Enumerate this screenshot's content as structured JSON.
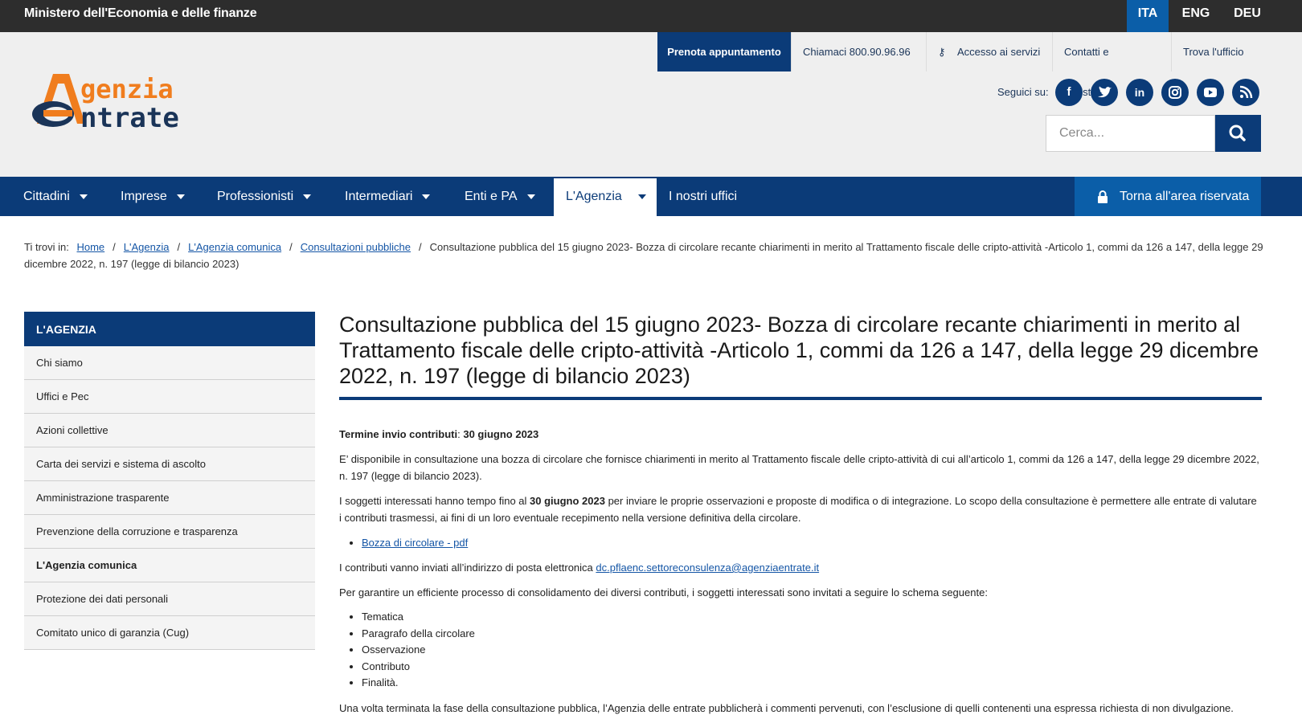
{
  "topbar": {
    "ministry": "Ministero dell'Economia e delle finanze",
    "languages": [
      "ITA",
      "ENG",
      "DEU"
    ]
  },
  "header": {
    "logo_line1": "genzia",
    "logo_line2": "ntrate",
    "services": {
      "prenota": "Prenota appuntamento",
      "chiamaci": "Chiamaci 800.90.96.96",
      "accesso": "Accesso ai servizi",
      "contatti": "Contatti e assistenza",
      "trova": "Trova l'ufficio"
    },
    "social_label": "Seguici su:",
    "social": [
      "facebook",
      "twitter",
      "linkedin",
      "instagram",
      "youtube",
      "rss"
    ],
    "search_placeholder": "Cerca..."
  },
  "nav": {
    "items": [
      "Cittadini",
      "Imprese",
      "Professionisti",
      "Intermediari",
      "Enti e PA",
      "L'Agenzia",
      "I nostri uffici"
    ],
    "reserved": "Torna all'area riservata"
  },
  "breadcrumb": {
    "label": "Ti trovi in:",
    "links": [
      "Home",
      "L'Agenzia",
      "L'Agenzia comunica",
      "Consultazioni pubbliche"
    ],
    "current": "Consultazione pubblica del 15 giugno 2023- Bozza di circolare recante chiarimenti in merito al Trattamento fiscale delle cripto-attività -Articolo 1, commi da 126 a 147, della legge 29 dicembre 2022, n. 197 (legge di bilancio 2023)"
  },
  "sidebar": {
    "title": "L'AGENZIA",
    "items": [
      "Chi siamo",
      "Uffici e Pec",
      "Azioni collettive",
      "Carta dei servizi e sistema di ascolto",
      "Amministrazione trasparente",
      "Prevenzione della corruzione e trasparenza",
      "L'Agenzia comunica",
      "Protezione dei dati personali",
      "Comitato unico di garanzia (Cug)"
    ],
    "active_item": "L'Agenzia comunica"
  },
  "main": {
    "title": "Consultazione pubblica del 15 giugno 2023- Bozza di circolare recante chiarimenti in merito al Trattamento fiscale delle cripto-attività -Articolo 1, commi da 126 a 147, della legge 29 dicembre 2022, n. 197 (legge di bilancio 2023)",
    "deadline_label": "Termine invio contributi",
    "deadline_value": "30 giugno 2023",
    "para1": "E’ disponibile in consultazione una bozza di circolare che fornisce chiarimenti in merito al Trattamento fiscale delle cripto-attività di cui all’articolo 1, commi da 126 a 147, della legge 29 dicembre 2022, n. 197 (legge di bilancio 2023).",
    "para2_before": "I soggetti interessati hanno tempo fino al ",
    "para2_bold": "30 giugno 2023",
    "para2_after": " per inviare le proprie osservazioni e proposte di modifica o di integrazione. Lo scopo della consultazione è permettere alle entrate di valutare i contributi trasmessi, ai fini di un loro eventuale recepimento nella versione definitiva della circolare.",
    "doc_link": "Bozza di circolare - pdf",
    "email_before": "I contributi vanno inviati all’indirizzo di posta elettronica ",
    "email": "dc.pflaenc.settoreconsulenza@agenziaentrate.it",
    "scheme_intro": "Per garantire un efficiente processo di consolidamento dei diversi contributi, i soggetti interessati sono invitati a seguire lo schema seguente:",
    "scheme": [
      "Tematica",
      "Paragrafo della circolare",
      "Osservazione",
      "Contributo",
      "Finalità."
    ],
    "closing": "Una volta terminata la fase della consultazione pubblica, l’Agenzia delle entrate pubblicherà i commenti pervenuti, con l’esclusione di quelli contenenti una espressa richiesta di non divulgazione."
  },
  "colors": {
    "brand_blue": "#0b3b78",
    "accent_blue": "#0b5ea8",
    "orange": "#f07d1e"
  }
}
